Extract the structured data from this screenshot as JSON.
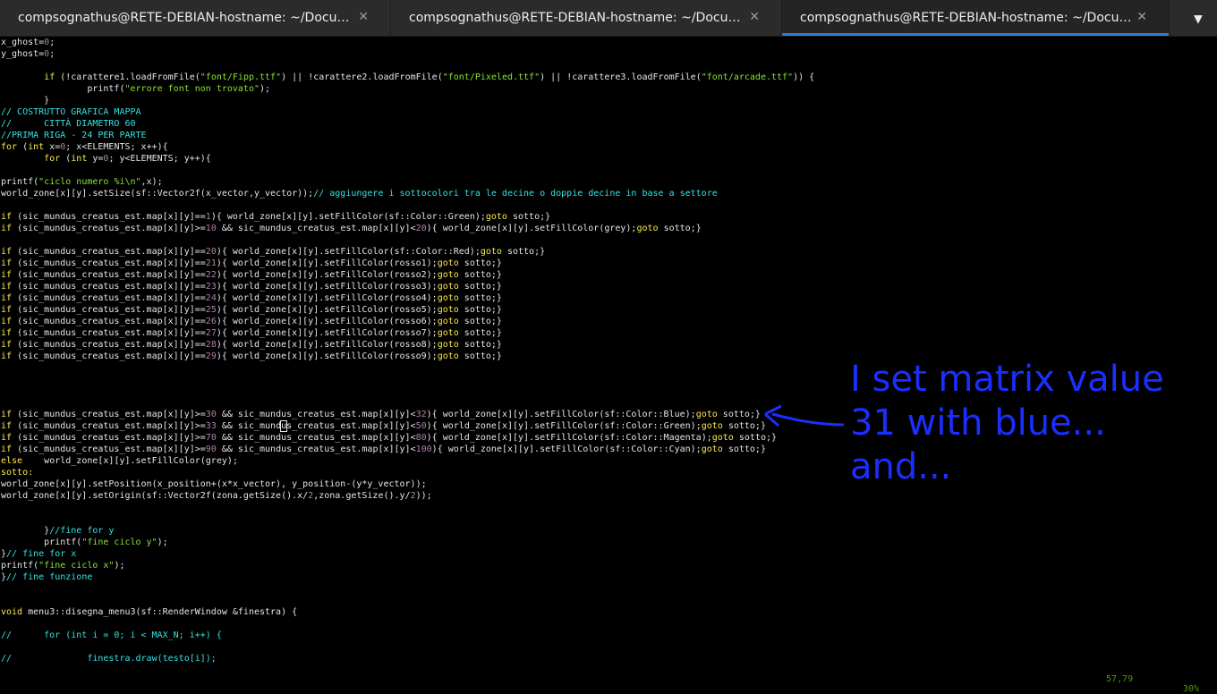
{
  "tabs": [
    {
      "label": "compsognathus@RETE-DEBIAN-hostname: ~/Documents/...",
      "active": false
    },
    {
      "label": "compsognathus@RETE-DEBIAN-hostname: ~/Documents/...",
      "active": false
    },
    {
      "label": "compsognathus@RETE-DEBIAN-hostname: ~/Documents/...",
      "active": true
    }
  ],
  "tab_close_glyph": "✕",
  "menu_glyph": "▼",
  "status": {
    "position": "57,79",
    "percent": "30%"
  },
  "annotation": {
    "line1": "I set matrix value",
    "line2": "31 with blue...",
    "line3": "and..."
  },
  "colors": {
    "annotation": "#1a2fff",
    "active_tab_underline": "#2d7dd2",
    "background": "#000000"
  },
  "code_lines": [
    "x_ghost=0;",
    "y_ghost=0;",
    "",
    "        if (!carattere1.loadFromFile(\"font/Fipp.ttf\") || !carattere2.loadFromFile(\"font/Pixeled.ttf\") || !carattere3.loadFromFile(\"font/arcade.ttf\")) {",
    "                printf(\"errore font non trovato\");",
    "        }",
    "// COSTRUTTO GRAFICA MAPPA",
    "//      CITTÀ DIAMETRO 60",
    "//PRIMA RIGA - 24 PER PARTE",
    "for (int x=0; x<ELEMENTS; x++){",
    "        for (int y=0; y<ELEMENTS; y++){",
    "",
    "printf(\"ciclo numero %i\\n\",x);",
    "world_zone[x][y].setSize(sf::Vector2f(x_vector,y_vector));// aggiungere i sottocolori tra le decine o doppie decine in base a settore",
    "",
    "if (sic_mundus_creatus_est.map[x][y]==1){ world_zone[x][y].setFillColor(sf::Color::Green);goto sotto;}",
    "if (sic_mundus_creatus_est.map[x][y]>=10 && sic_mundus_creatus_est.map[x][y]<20){ world_zone[x][y].setFillColor(grey);goto sotto;}",
    "",
    "if (sic_mundus_creatus_est.map[x][y]==20){ world_zone[x][y].setFillColor(sf::Color::Red);goto sotto;}",
    "if (sic_mundus_creatus_est.map[x][y]==21){ world_zone[x][y].setFillColor(rosso1);goto sotto;}",
    "if (sic_mundus_creatus_est.map[x][y]==22){ world_zone[x][y].setFillColor(rosso2);goto sotto;}",
    "if (sic_mundus_creatus_est.map[x][y]==23){ world_zone[x][y].setFillColor(rosso3);goto sotto;}",
    "if (sic_mundus_creatus_est.map[x][y]==24){ world_zone[x][y].setFillColor(rosso4);goto sotto;}",
    "if (sic_mundus_creatus_est.map[x][y]==25){ world_zone[x][y].setFillColor(rosso5);goto sotto;}",
    "if (sic_mundus_creatus_est.map[x][y]==26){ world_zone[x][y].setFillColor(rosso6);goto sotto;}",
    "if (sic_mundus_creatus_est.map[x][y]==27){ world_zone[x][y].setFillColor(rosso7);goto sotto;}",
    "if (sic_mundus_creatus_est.map[x][y]==28){ world_zone[x][y].setFillColor(rosso8);goto sotto;}",
    "if (sic_mundus_creatus_est.map[x][y]==29){ world_zone[x][y].setFillColor(rosso9);goto sotto;}",
    "",
    "",
    "",
    "",
    "if (sic_mundus_creatus_est.map[x][y]>=30 && sic_mundus_creatus_est.map[x][y]<32){ world_zone[x][y].setFillColor(sf::Color::Blue);goto sotto;}",
    "if (sic_mundus_creatus_est.map[x][y]>=33 && sic_mundus_creatus_est.map[x][y]<50){ world_zone[x][y].setFillColor(sf::Color::Green);goto sotto;}",
    "if (sic_mundus_creatus_est.map[x][y]>=70 && sic_mundus_creatus_est.map[x][y]<80){ world_zone[x][y].setFillColor(sf::Color::Magenta);goto sotto;}",
    "if (sic_mundus_creatus_est.map[x][y]>=90 && sic_mundus_creatus_est.map[x][y]<100){ world_zone[x][y].setFillColor(sf::Color::Cyan);goto sotto;}",
    "else    world_zone[x][y].setFillColor(grey);",
    "sotto:",
    "world_zone[x][y].setPosition(x_position+(x*x_vector), y_position-(y*y_vector));",
    "world_zone[x][y].setOrigin(sf::Vector2f(zona.getSize().x/2,zona.getSize().y/2));",
    "",
    "",
    "        }//fine for y",
    "        printf(\"fine ciclo y\");",
    "}// fine for x",
    "printf(\"fine ciclo x\");",
    "}// fine funzione",
    "",
    "",
    "void menu3::disegna_menu3(sf::RenderWindow &finestra) {",
    "",
    "//      for (int i = 0; i < MAX_N; i++) {",
    "",
    "//              finestra.draw(testo[i]);"
  ],
  "cursor": {
    "line": 33,
    "column": 52
  }
}
